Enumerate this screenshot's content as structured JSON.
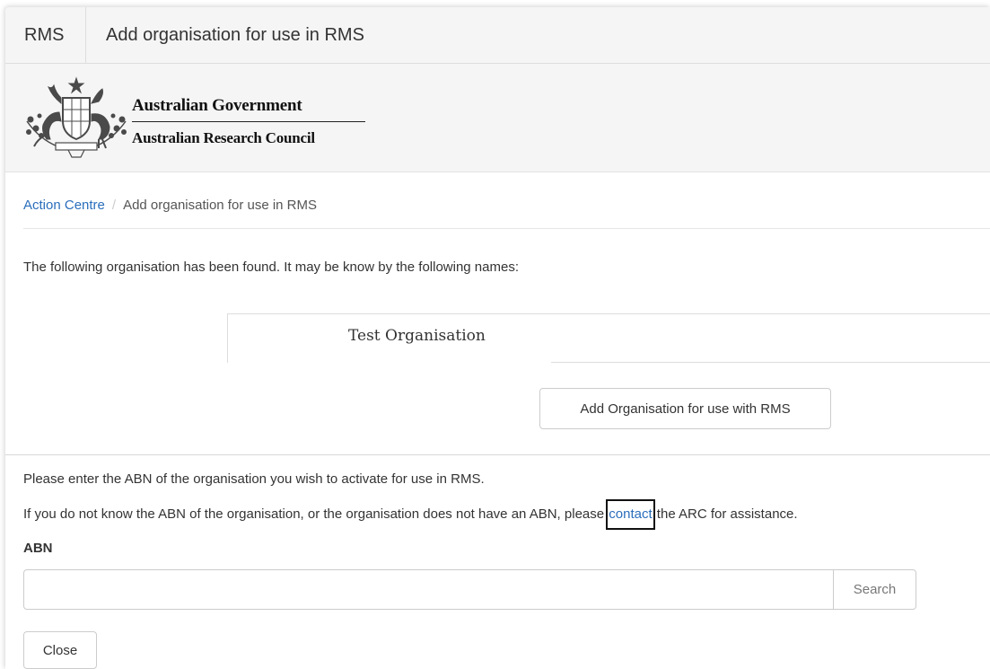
{
  "titlebar": {
    "app": "RMS",
    "title": "Add organisation for use in RMS"
  },
  "branding": {
    "government": "Australian Government",
    "council": "Australian Research Council",
    "crest_icon": "coat-of-arms-icon"
  },
  "breadcrumb": {
    "home": "Action Centre",
    "separator": "/",
    "current": "Add organisation for use in RMS"
  },
  "found": {
    "message": "The following organisation has been found. It may be know by the following names:",
    "names": [
      "Test Organisation"
    ],
    "add_button": "Add Organisation for use with RMS"
  },
  "abn_section": {
    "instruction": "Please enter the ABN of the organisation you wish to activate for use in RMS.",
    "help_prefix": "If you do not know the ABN of the organisation, or the organisation does not have an ABN, please ",
    "help_link": "contact",
    "help_suffix": " the ARC for assistance.",
    "label": "ABN",
    "input_value": "",
    "input_placeholder": "",
    "search_button": "Search"
  },
  "footer": {
    "close_button": "Close"
  },
  "colors": {
    "link": "#2a6ebb",
    "header_bg": "#f5f5f5",
    "border": "#cccccc"
  }
}
